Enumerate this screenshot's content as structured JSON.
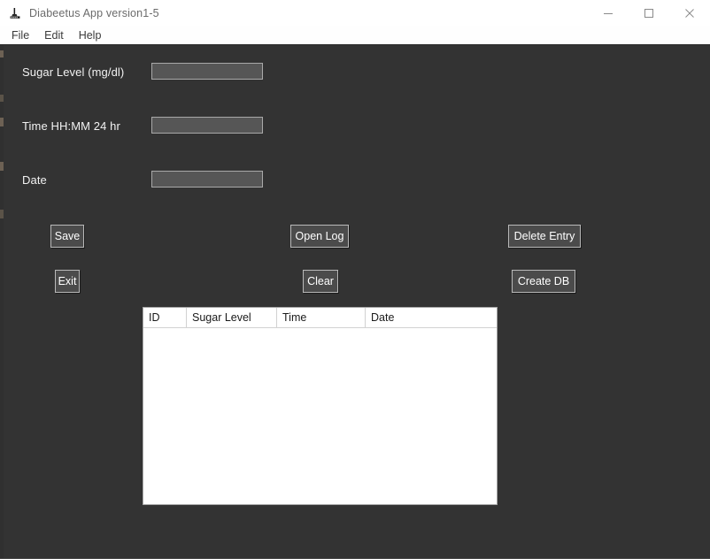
{
  "window": {
    "title": "Diabeetus App version1-5",
    "icon": "app-icon",
    "background_color": "#333333",
    "titlebar_color": "#ffffff",
    "controls": [
      {
        "name": "minimize",
        "glyph": "minimize-icon"
      },
      {
        "name": "maximize",
        "glyph": "maximize-icon"
      },
      {
        "name": "close",
        "glyph": "close-icon"
      }
    ]
  },
  "menubar": {
    "items": [
      {
        "label": "File"
      },
      {
        "label": "Edit"
      },
      {
        "label": "Help"
      }
    ]
  },
  "form": {
    "fields": [
      {
        "label": "Sugar Level (mg/dl)",
        "value": "",
        "placeholder": ""
      },
      {
        "label": "Time HH:MM 24 hr",
        "value": "",
        "placeholder": ""
      },
      {
        "label": "Date",
        "value": "",
        "placeholder": ""
      }
    ]
  },
  "buttons": {
    "save": "Save",
    "exit": "Exit",
    "open_log": "Open Log",
    "clear": "Clear",
    "delete_entry": "Delete Entry",
    "create_db": "Create DB"
  },
  "table": {
    "columns": [
      "ID",
      "Sugar Level",
      "Time",
      "Date"
    ],
    "rows": []
  },
  "colors": {
    "window_bg": "#333333",
    "input_bg": "#565656",
    "button_bg": "#4b4b4b",
    "button_border": "#b9b9b9",
    "text": "#f2f2f2",
    "table_bg": "#ffffff"
  }
}
